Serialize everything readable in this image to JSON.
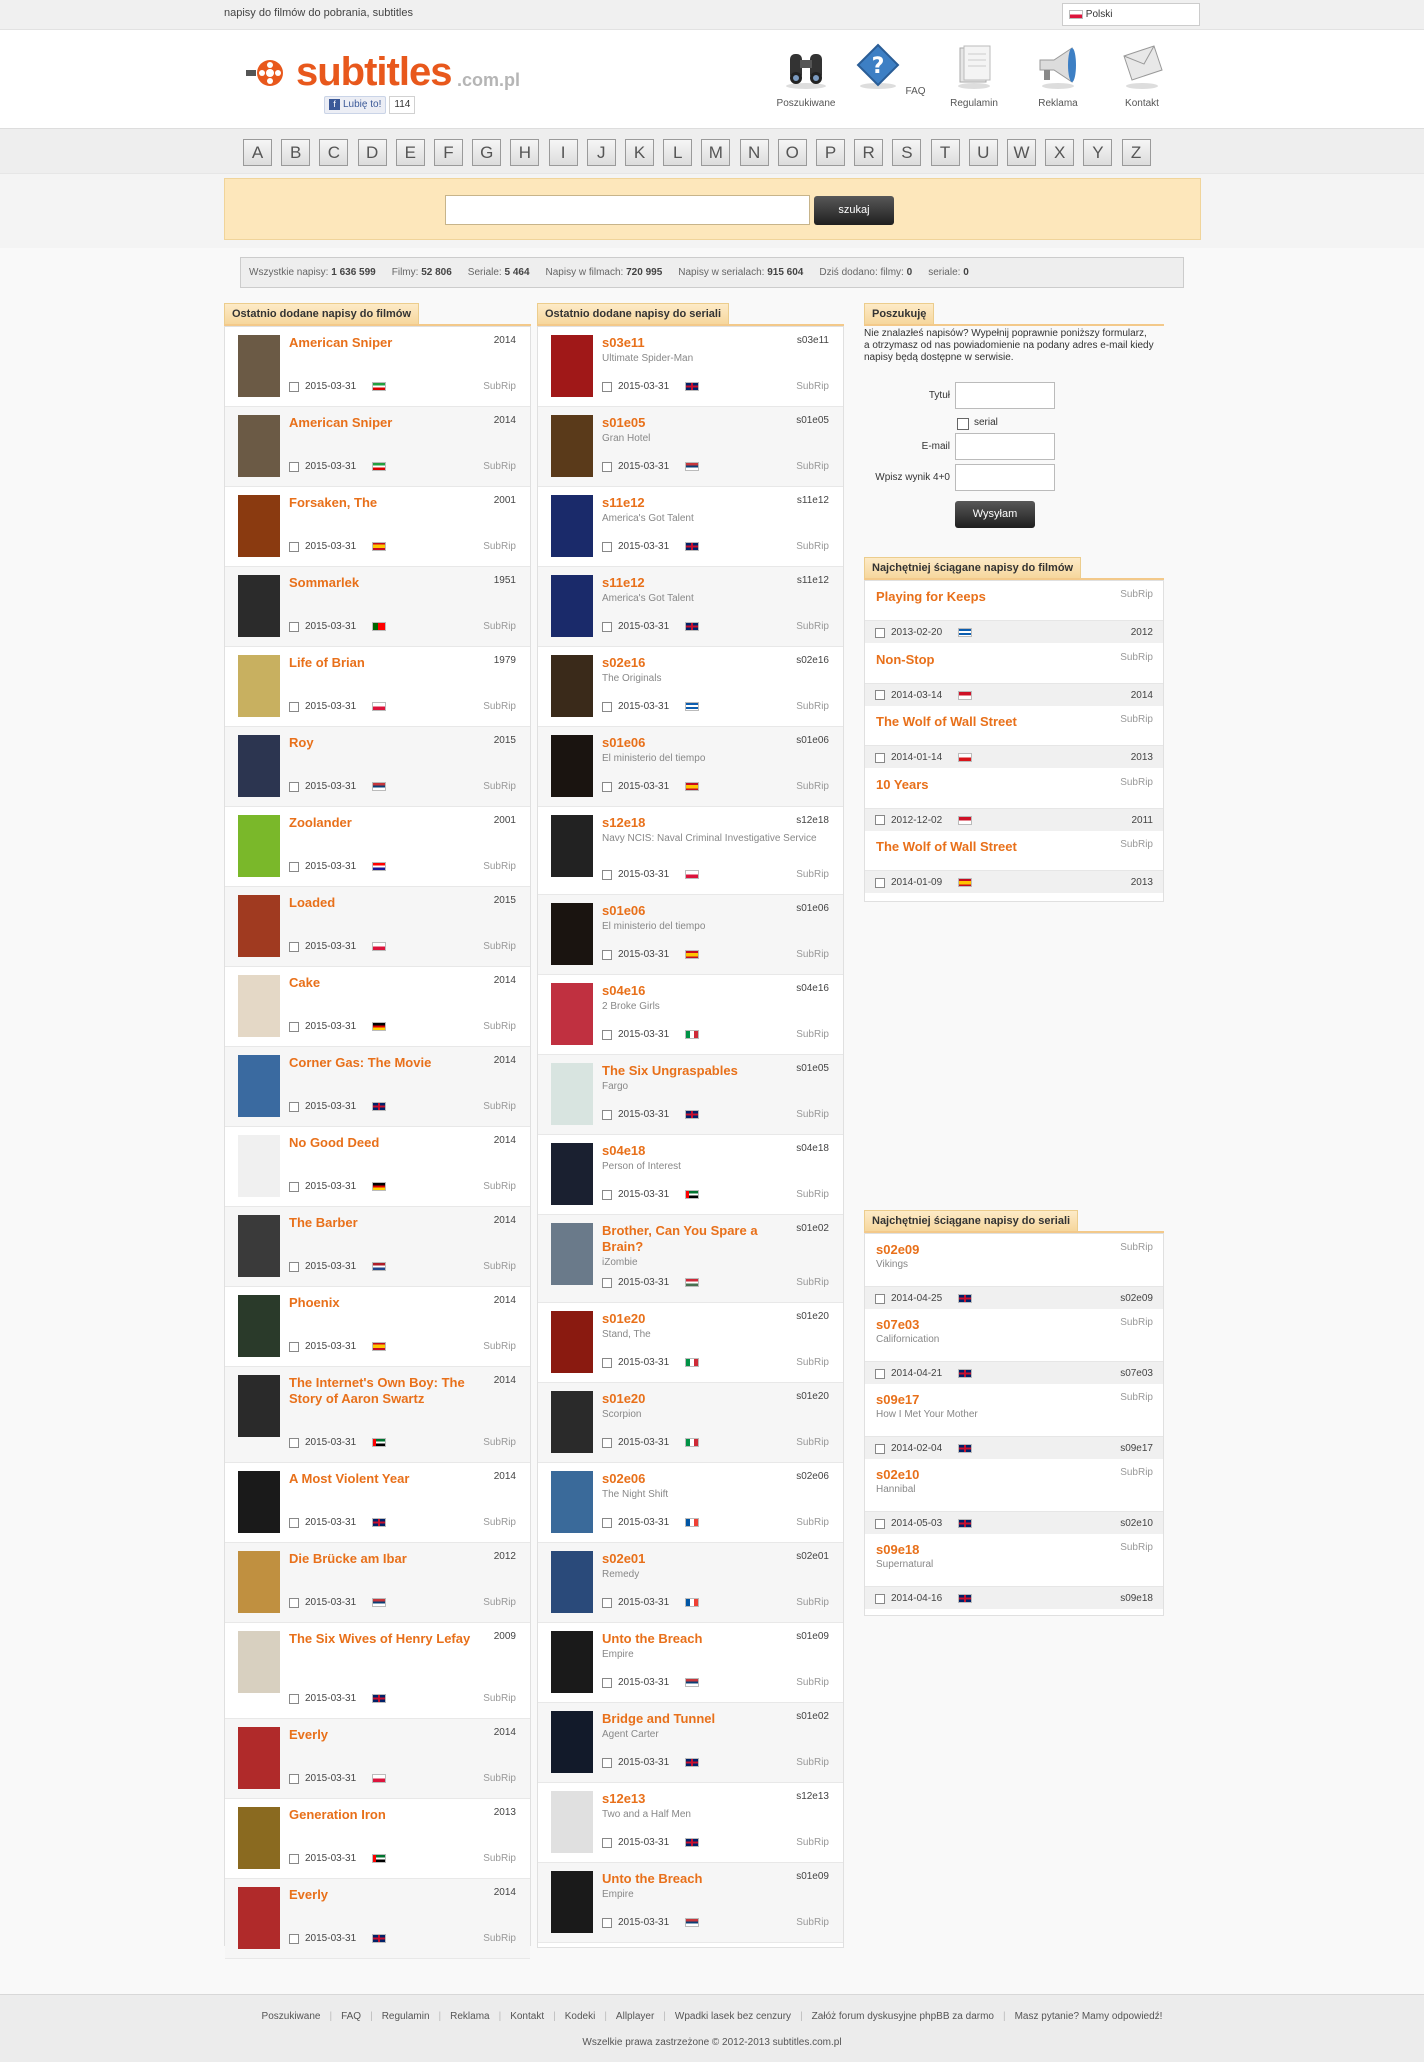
{
  "top": {
    "tagline": "napisy do filmów do pobrania, subtitles",
    "language": "Polski"
  },
  "logo": {
    "word": "subtitles",
    "domain": ".com.pl"
  },
  "facebook": {
    "like": "Lubię to!",
    "count": "114"
  },
  "nav": [
    {
      "label": "Poszukiwane",
      "icon": "binoculars-icon"
    },
    {
      "label": "FAQ",
      "icon": "question-icon"
    },
    {
      "label": "Regulamin",
      "icon": "document-icon"
    },
    {
      "label": "Reklama",
      "icon": "megaphone-icon"
    },
    {
      "label": "Kontakt",
      "icon": "envelope-icon"
    }
  ],
  "alphabet": [
    "A",
    "B",
    "C",
    "D",
    "E",
    "F",
    "G",
    "H",
    "I",
    "J",
    "K",
    "L",
    "M",
    "N",
    "O",
    "P",
    "R",
    "S",
    "T",
    "U",
    "W",
    "X",
    "Y",
    "Z"
  ],
  "search": {
    "button": "szukaj",
    "value": ""
  },
  "stats": [
    {
      "label": "Wszystkie napisy:",
      "value": "1 636 599"
    },
    {
      "label": "Filmy:",
      "value": "52 806"
    },
    {
      "label": "Seriale:",
      "value": "5 464"
    },
    {
      "label": "Napisy w filmach:",
      "value": "720 995"
    },
    {
      "label": "Napisy w serialach:",
      "value": "915 604"
    },
    {
      "label": "Dziś dodano: filmy:",
      "value": "0"
    },
    {
      "label": "seriale:",
      "value": "0"
    }
  ],
  "movies": {
    "heading": "Ostatnio dodane napisy do filmów",
    "items": [
      {
        "title": "American Sniper",
        "year": "2014",
        "date": "2015-03-31",
        "flag": "ir",
        "fmt": "SubRip",
        "poster": "#6b5a45"
      },
      {
        "title": "American Sniper",
        "year": "2014",
        "date": "2015-03-31",
        "flag": "ir",
        "fmt": "SubRip",
        "poster": "#6b5a45"
      },
      {
        "title": "Forsaken, The",
        "year": "2001",
        "date": "2015-03-31",
        "flag": "es",
        "fmt": "SubRip",
        "poster": "#8a3a10"
      },
      {
        "title": "Sommarlek",
        "year": "1951",
        "date": "2015-03-31",
        "flag": "pt",
        "fmt": "SubRip",
        "poster": "#2b2b2b"
      },
      {
        "title": "Life of Brian",
        "year": "1979",
        "date": "2015-03-31",
        "flag": "pl",
        "fmt": "SubRip",
        "poster": "#c8b060"
      },
      {
        "title": "Roy",
        "year": "2015",
        "date": "2015-03-31",
        "flag": "rs",
        "fmt": "SubRip",
        "poster": "#2c3550"
      },
      {
        "title": "Zoolander",
        "year": "2001",
        "date": "2015-03-31",
        "flag": "hr",
        "fmt": "SubRip",
        "poster": "#7ab82a"
      },
      {
        "title": "Loaded",
        "year": "2015",
        "date": "2015-03-31",
        "flag": "pl",
        "fmt": "SubRip",
        "poster": "#a03a20"
      },
      {
        "title": "Cake",
        "year": "2014",
        "date": "2015-03-31",
        "flag": "de",
        "fmt": "SubRip",
        "poster": "#e4d8c6"
      },
      {
        "title": "Corner Gas: The Movie",
        "year": "2014",
        "date": "2015-03-31",
        "flag": "gb",
        "fmt": "SubRip",
        "poster": "#3a6aa0"
      },
      {
        "title": "No Good Deed",
        "year": "2014",
        "date": "2015-03-31",
        "flag": "de",
        "fmt": "SubRip",
        "poster": "#f0f0f0"
      },
      {
        "title": "The Barber",
        "year": "2014",
        "date": "2015-03-31",
        "flag": "nl",
        "fmt": "SubRip",
        "poster": "#3a3a3a"
      },
      {
        "title": "Phoenix",
        "year": "2014",
        "date": "2015-03-31",
        "flag": "es",
        "fmt": "SubRip",
        "poster": "#2a3a2a"
      },
      {
        "title": "The Internet's Own Boy: The Story of Aaron Swartz",
        "year": "2014",
        "date": "2015-03-31",
        "flag": "ae",
        "fmt": "SubRip",
        "poster": "#2a2a2a"
      },
      {
        "title": "A Most Violent Year",
        "year": "2014",
        "date": "2015-03-31",
        "flag": "gb",
        "fmt": "SubRip",
        "poster": "#1a1a1a"
      },
      {
        "title": "Die Brücke am Ibar",
        "year": "2012",
        "date": "2015-03-31",
        "flag": "rs",
        "fmt": "SubRip",
        "poster": "#c09040"
      },
      {
        "title": "The Six Wives of Henry Lefay",
        "year": "2009",
        "date": "2015-03-31",
        "flag": "gb",
        "fmt": "SubRip",
        "poster": "#d8d0c0"
      },
      {
        "title": "Everly",
        "year": "2014",
        "date": "2015-03-31",
        "flag": "pl",
        "fmt": "SubRip",
        "poster": "#b02a2a"
      },
      {
        "title": "Generation Iron",
        "year": "2013",
        "date": "2015-03-31",
        "flag": "ae",
        "fmt": "SubRip",
        "poster": "#8a6a20"
      },
      {
        "title": "Everly",
        "year": "2014",
        "date": "2015-03-31",
        "flag": "gb",
        "fmt": "SubRip",
        "poster": "#b02a2a"
      }
    ]
  },
  "series": {
    "heading": "Ostatnio dodane napisy do seriali",
    "items": [
      {
        "title": "s03e11",
        "show": "Ultimate Spider-Man",
        "ep": "s03e11",
        "date": "2015-03-31",
        "flag": "gb",
        "fmt": "SubRip",
        "poster": "#a01818"
      },
      {
        "title": "s01e05",
        "show": "Gran Hotel",
        "ep": "s01e05",
        "date": "2015-03-31",
        "flag": "rs",
        "fmt": "SubRip",
        "poster": "#5a3a1a"
      },
      {
        "title": "s11e12",
        "show": "America's Got Talent",
        "ep": "s11e12",
        "date": "2015-03-31",
        "flag": "gb",
        "fmt": "SubRip",
        "poster": "#1a2a6a"
      },
      {
        "title": "s11e12",
        "show": "America's Got Talent",
        "ep": "s11e12",
        "date": "2015-03-31",
        "flag": "gb",
        "fmt": "SubRip",
        "poster": "#1a2a6a"
      },
      {
        "title": "s02e16",
        "show": "The Originals",
        "ep": "s02e16",
        "date": "2015-03-31",
        "flag": "gr",
        "fmt": "SubRip",
        "poster": "#3a2a1a"
      },
      {
        "title": "s01e06",
        "show": "El ministerio del tiempo",
        "ep": "s01e06",
        "date": "2015-03-31",
        "flag": "es",
        "fmt": "SubRip",
        "poster": "#1a1410"
      },
      {
        "title": "s12e18",
        "show": "Navy NCIS: Naval Criminal Investigative Service",
        "ep": "s12e18",
        "date": "2015-03-31",
        "flag": "pl",
        "fmt": "SubRip",
        "poster": "#222"
      },
      {
        "title": "s01e06",
        "show": "El ministerio del tiempo",
        "ep": "s01e06",
        "date": "2015-03-31",
        "flag": "es",
        "fmt": "SubRip",
        "poster": "#1a1410"
      },
      {
        "title": "s04e16",
        "show": "2 Broke Girls",
        "ep": "s04e16",
        "date": "2015-03-31",
        "flag": "it",
        "fmt": "SubRip",
        "poster": "#c03040"
      },
      {
        "title": "The Six Ungraspables",
        "show": "Fargo",
        "ep": "s01e05",
        "date": "2015-03-31",
        "flag": "gb",
        "fmt": "SubRip",
        "poster": "#d8e4e0"
      },
      {
        "title": "s04e18",
        "show": "Person of Interest",
        "ep": "s04e18",
        "date": "2015-03-31",
        "flag": "ae",
        "fmt": "SubRip",
        "poster": "#1a2030"
      },
      {
        "title": "Brother, Can You Spare a Brain?",
        "show": "iZombie",
        "ep": "s01e02",
        "date": "2015-03-31",
        "flag": "hu",
        "fmt": "SubRip",
        "poster": "#6a7a8a"
      },
      {
        "title": "s01e20",
        "show": "Stand, The",
        "ep": "s01e20",
        "date": "2015-03-31",
        "flag": "it",
        "fmt": "SubRip",
        "poster": "#8a1a10"
      },
      {
        "title": "s01e20",
        "show": "Scorpion",
        "ep": "s01e20",
        "date": "2015-03-31",
        "flag": "it",
        "fmt": "SubRip",
        "poster": "#2a2a2a"
      },
      {
        "title": "s02e06",
        "show": "The Night Shift",
        "ep": "s02e06",
        "date": "2015-03-31",
        "flag": "fr",
        "fmt": "SubRip",
        "poster": "#3a6a9a"
      },
      {
        "title": "s02e01",
        "show": "Remedy",
        "ep": "s02e01",
        "date": "2015-03-31",
        "flag": "fr",
        "fmt": "SubRip",
        "poster": "#2a4a7a"
      },
      {
        "title": "Unto the Breach",
        "show": "Empire",
        "ep": "s01e09",
        "date": "2015-03-31",
        "flag": "rs",
        "fmt": "SubRip",
        "poster": "#1a1a1a"
      },
      {
        "title": "Bridge and Tunnel",
        "show": "Agent Carter",
        "ep": "s01e02",
        "date": "2015-03-31",
        "flag": "gb",
        "fmt": "SubRip",
        "poster": "#121a2a"
      },
      {
        "title": "s12e13",
        "show": "Two and a Half Men",
        "ep": "s12e13",
        "date": "2015-03-31",
        "flag": "gb",
        "fmt": "SubRip",
        "poster": "#e0e0e0"
      },
      {
        "title": "Unto the Breach",
        "show": "Empire",
        "ep": "s01e09",
        "date": "2015-03-31",
        "flag": "rs",
        "fmt": "SubRip",
        "poster": "#1a1a1a"
      }
    ]
  },
  "request": {
    "heading": "Poszukuję",
    "text": "Nie znalazłeś napisów? Wypełnij poprawnie poniższy formularz, a otrzymasz od nas powiadomienie na podany adres e-mail kiedy napisy będą dostępne w serwisie.",
    "title_label": "Tytuł",
    "serial_label": "serial",
    "email_label": "E-mail",
    "captcha_label": "Wpisz wynik 4+0",
    "send": "Wysyłam"
  },
  "top_movies": {
    "heading": "Najchętniej ściągane napisy do filmów",
    "items": [
      {
        "title": "Playing for Keeps",
        "fmt": "SubRip",
        "date": "2013-02-20",
        "flag": "gr",
        "year": "2012"
      },
      {
        "title": "Non-Stop",
        "fmt": "SubRip",
        "date": "2014-03-14",
        "flag": "id",
        "year": "2014"
      },
      {
        "title": "The Wolf of Wall Street",
        "fmt": "SubRip",
        "date": "2014-01-14",
        "flag": "cz",
        "year": "2013"
      },
      {
        "title": "10 Years",
        "fmt": "SubRip",
        "date": "2012-12-02",
        "flag": "id",
        "year": "2011"
      },
      {
        "title": "The Wolf of Wall Street",
        "fmt": "SubRip",
        "date": "2014-01-09",
        "flag": "es",
        "year": "2013"
      }
    ]
  },
  "top_series": {
    "heading": "Najchętniej ściągane napisy do seriali",
    "items": [
      {
        "title": "s02e09",
        "show": "Vikings",
        "fmt": "SubRip",
        "date": "2014-04-25",
        "flag": "gb",
        "ep": "s02e09"
      },
      {
        "title": "s07e03",
        "show": "Californication",
        "fmt": "SubRip",
        "date": "2014-04-21",
        "flag": "gb",
        "ep": "s07e03"
      },
      {
        "title": "s09e17",
        "show": "How I Met Your Mother",
        "fmt": "SubRip",
        "date": "2014-02-04",
        "flag": "gb",
        "ep": "s09e17"
      },
      {
        "title": "s02e10",
        "show": "Hannibal",
        "fmt": "SubRip",
        "date": "2014-05-03",
        "flag": "gb",
        "ep": "s02e10"
      },
      {
        "title": "s09e18",
        "show": "Supernatural",
        "fmt": "SubRip",
        "date": "2014-04-16",
        "flag": "gb",
        "ep": "s09e18"
      }
    ]
  },
  "footer": {
    "links": [
      "Poszukiwane",
      "FAQ",
      "Regulamin",
      "Reklama",
      "Kontakt",
      "Kodeki",
      "Allplayer",
      "Wpadki lasek bez cenzury",
      "Załóż forum dyskusyjne phpBB za darmo",
      "Masz pytanie? Mamy odpowiedź!"
    ],
    "copyright": "Wszelkie prawa zastrzeżone © 2012-2013 subtitles.com.pl"
  }
}
